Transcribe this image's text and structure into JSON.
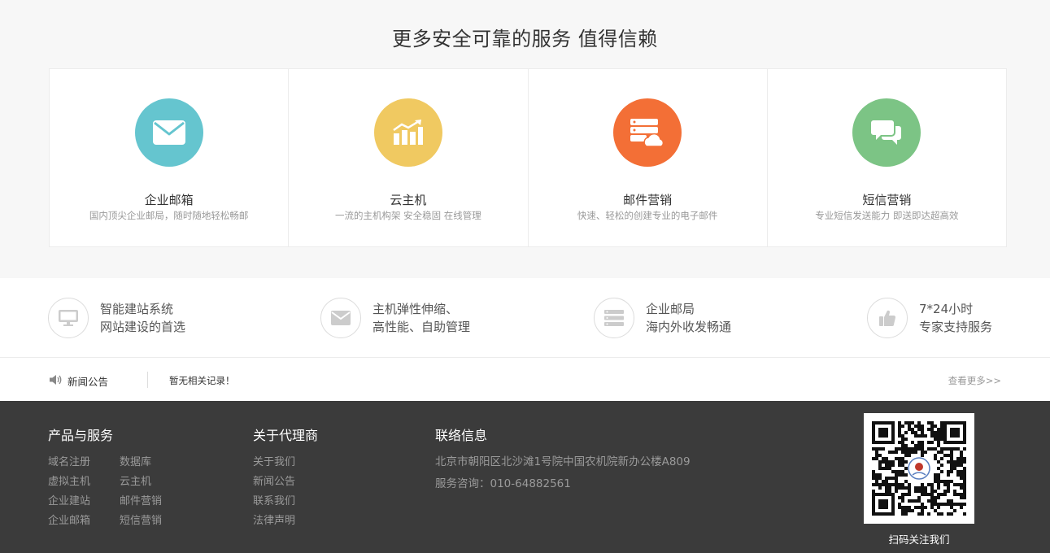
{
  "services": {
    "title": "更多安全可靠的服务 值得信赖",
    "cards": [
      {
        "title": "企业邮箱",
        "desc": "国内顶尖企业邮局，随时随地轻松畅邮",
        "color": "#65c5cf",
        "icon": "mail-icon"
      },
      {
        "title": "云主机",
        "desc": "一流的主机构架 安全稳固 在线管理",
        "color": "#f0c961",
        "icon": "growth-chart-icon"
      },
      {
        "title": "邮件营销",
        "desc": "快速、轻松的创建专业的电子邮件",
        "color": "#f36f36",
        "icon": "server-cloud-icon"
      },
      {
        "title": "短信营销",
        "desc": "专业短信发送能力 即送即达超高效",
        "color": "#7cc485",
        "icon": "chat-bubbles-icon"
      }
    ]
  },
  "features": [
    {
      "line1": "智能建站系统",
      "line2": "网站建设的首选",
      "icon": "monitor-icon"
    },
    {
      "line1": "主机弹性伸缩、",
      "line2": "高性能、自助管理",
      "icon": "envelope-icon"
    },
    {
      "line1": "企业邮局",
      "line2": "海内外收发畅通",
      "icon": "server-icon"
    },
    {
      "line1": "7*24小时",
      "line2": "专家支持服务",
      "icon": "thumbs-up-icon"
    }
  ],
  "news": {
    "label": "新闻公告",
    "content": "暂无相关记录！",
    "more": "查看更多>>"
  },
  "footer": {
    "products": {
      "title": "产品与服务",
      "links": [
        "域名注册",
        "数据库",
        "虚拟主机",
        "云主机",
        "企业建站",
        "邮件营销",
        "企业邮箱",
        "短信营销"
      ]
    },
    "agents": {
      "title": "关于代理商",
      "links": [
        "关于我们",
        "新闻公告",
        "联系我们",
        "法律声明"
      ]
    },
    "contact": {
      "title": "联络信息",
      "address": "北京市朝阳区北沙滩1号院中国农机院新办公楼A809",
      "phone": "服务咨询：010-64882561"
    },
    "qr_caption": "扫码关注我们"
  }
}
